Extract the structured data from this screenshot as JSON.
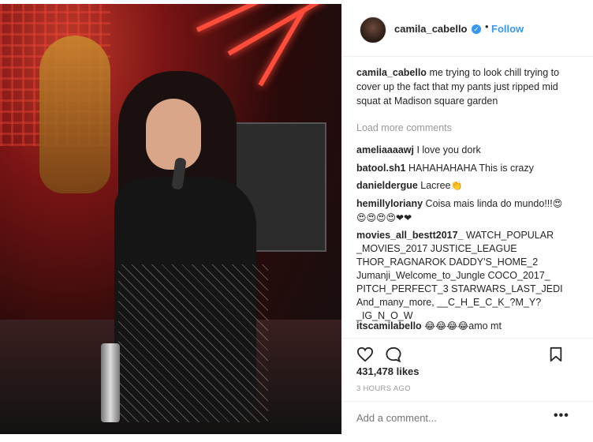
{
  "header": {
    "username": "camila_cabello",
    "verified_glyph": "✓",
    "separator": "•",
    "follow_label": "Follow"
  },
  "caption": {
    "username": "camila_cabello",
    "text": "me trying to look chill trying to cover up the fact that my pants just ripped mid squat at Madison square garden"
  },
  "load_more_label": "Load more comments",
  "comments": [
    {
      "username": "ameliaaaawj",
      "text": "I love you dork"
    },
    {
      "username": "batool.sh1",
      "text": "HAHAHAHAHA This is crazy"
    },
    {
      "username": "danieldergue",
      "text": "Lacree",
      "emoji": "👏"
    },
    {
      "username": "hemillyloriany",
      "text": "Coisa mais linda do mundo!!!",
      "emoji": "😍😍😍😍😍❤❤"
    },
    {
      "username": "movies_all_bestt2017_",
      "text": "WATCH_POPULAR _MOVIES_2017 JUSTICE_LEAGUE THOR_RAGNAROK DADDY'S_HOME_2 Jumanji_Welcome_to_Jungle COCO_2017_ PITCH_PERFECT_3 STARWARS_LAST_JEDI And_many_more, __C_H_E_C_K_?M_Y? _IG_N_O_W"
    },
    {
      "username": "itscamilabello",
      "emoji": "😂😂😂😂",
      "text": "amo mt"
    }
  ],
  "stats": {
    "likes": "431,478 likes",
    "time": "3 HOURS AGO"
  },
  "composer": {
    "placeholder": "Add a comment...",
    "more_label": "•••"
  },
  "icons": {
    "like": "heart-icon",
    "comment": "comment-icon",
    "save": "bookmark-icon",
    "verified": "verified-badge-icon",
    "more": "more-options-icon"
  },
  "colors": {
    "link": "#3897f0",
    "text": "#262626",
    "muted": "#999999",
    "border": "#efefef"
  }
}
